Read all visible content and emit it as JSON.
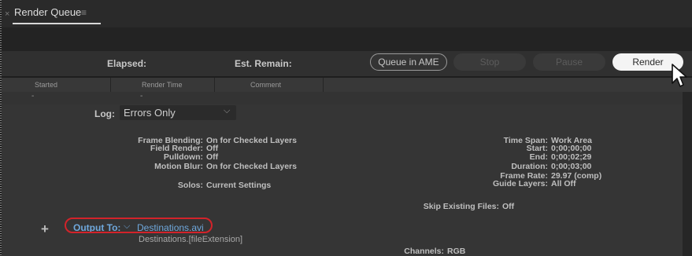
{
  "tab": {
    "close": "×",
    "title": "Render Queue",
    "menu": "≡"
  },
  "status": {
    "elapsed_label": "Elapsed:",
    "est_remain_label": "Est. Remain:"
  },
  "buttons": {
    "queue_ame": "Queue in AME",
    "stop": "Stop",
    "pause": "Pause",
    "render": "Render"
  },
  "columns": [
    "Started",
    "Render Time",
    "Comment"
  ],
  "row": {
    "started": "-",
    "render_time": "-"
  },
  "log": {
    "label": "Log:",
    "value": "Errors Only"
  },
  "render_settings": {
    "frame_blending_label": "Frame Blending:",
    "frame_blending": "On for Checked Layers",
    "field_render_label": "Field Render:",
    "field_render": "Off",
    "pulldown_label": "Pulldown:",
    "pulldown": "Off",
    "motion_blur_label": "Motion Blur:",
    "motion_blur": "On for Checked Layers",
    "solos_label": "Solos:",
    "solos": "Current Settings"
  },
  "time_settings": {
    "time_span_label": "Time Span:",
    "time_span": "Work Area",
    "start_label": "Start:",
    "start": "0;00;00;00",
    "end_label": "End:",
    "end": "0;00;02;29",
    "duration_label": "Duration:",
    "duration": "0;00;03;00",
    "frame_rate_label": "Frame Rate:",
    "frame_rate": "29.97 (comp)",
    "guide_layers_label": "Guide Layers:",
    "guide_layers": "All Off"
  },
  "skip_existing": {
    "label": "Skip Existing Files:",
    "value": "Off"
  },
  "output": {
    "plus": "+",
    "label": "Output To:",
    "file": "Destinations.avi",
    "template": "Destinations.[fileExtension]"
  },
  "channels": {
    "label": "Channels:",
    "value": "RGB"
  },
  "colors": {
    "accent_link": "#6fa8dc",
    "highlight_ring": "#d2232a",
    "render_button": "#f4f4f4"
  },
  "icons": [
    "close-icon",
    "panel-menu-icon",
    "chevron-down-icon",
    "plus-icon",
    "mouse-cursor-icon"
  ]
}
